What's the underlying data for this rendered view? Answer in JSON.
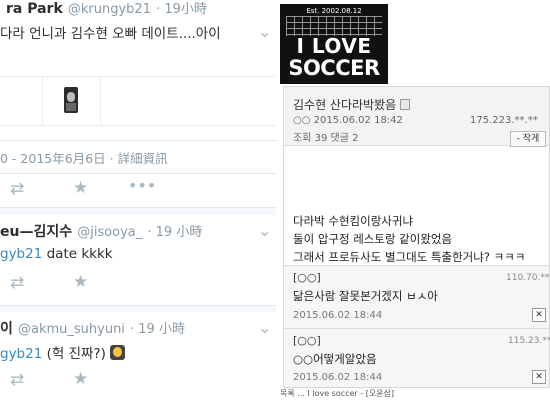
{
  "twitter": {
    "tweet1": {
      "name": "ra Park",
      "handle": "@krungyb21",
      "time": "· 19小時",
      "text": "다라 언니과 김수현 오빠 데이트....아이",
      "date": "0 - 2015年6月6日",
      "details_link": "· 詳細資訊"
    },
    "tweet2": {
      "name": "eu—김지수",
      "handle": "@jisooya_",
      "time": "· 19 小時",
      "mention": "gyb21",
      "text": " date kkkk"
    },
    "tweet3": {
      "name": "이",
      "handle": "@akmu_suhyuni",
      "time": "· 19 小時",
      "mention": "gyb21",
      "text": " (헉 진짜?)"
    }
  },
  "forum": {
    "logo": {
      "est": "Est. 2002.08.12",
      "line1": "I LOVE",
      "line2": "SOCCER"
    },
    "post": {
      "title": "김수현 산다라박봤음",
      "author": "○○",
      "datetime": "2015.06.02 18:42",
      "ip": "175.223.**.**",
      "views_label": "조회",
      "views": "39",
      "comments_label": "댓글",
      "comments": "2",
      "reply_button": "- 작게",
      "body": [
        "다라박 수현킴이랑사귀냐",
        "둘이 압구정 레스토랑 같이왔었음",
        "그래서 프로듀사도 별그대도 특출한거냐?  ㅋㅋㅋ"
      ]
    },
    "comments": [
      {
        "name": "[○○]",
        "ip": "110.70.**.**",
        "text": "닮은사람 잘못본거겠지 ㅂㅅ아",
        "date": "2015.06.02 18:44",
        "close": "✕"
      },
      {
        "name": "[○○]",
        "ip": "115.23.**.**",
        "text": "○○어떻게알았음",
        "date": "2015.06.02 18:44",
        "close": "✕"
      }
    ],
    "footer": "목록 ...     I love soccer - [오윤삼]"
  }
}
